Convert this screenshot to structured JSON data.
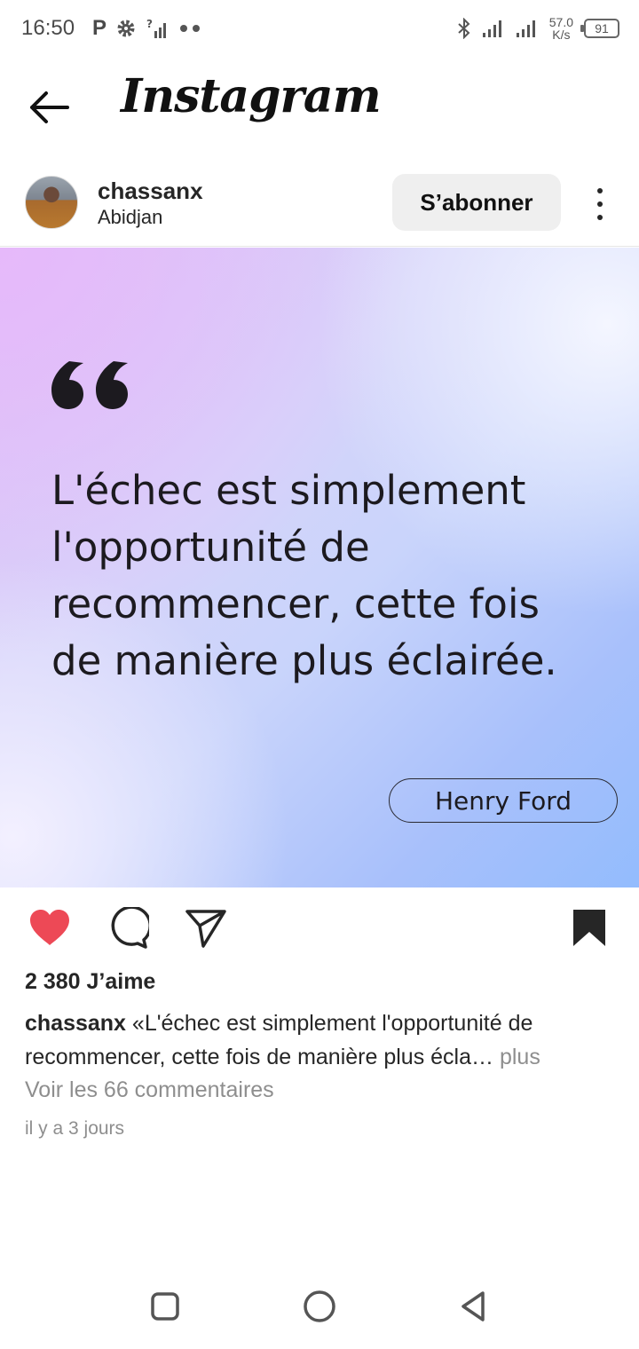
{
  "status_bar": {
    "time": "16:50",
    "left_icons": [
      "parking-icon",
      "gear-icon",
      "signal-unknown-icon",
      "dots-icon"
    ],
    "network_speed_value": "57.0",
    "network_speed_unit": "K/s",
    "battery_level": "91"
  },
  "header": {
    "brand": "Instagram",
    "back_icon": "arrow-left-icon"
  },
  "post": {
    "username": "chassanx",
    "location": "Abidjan",
    "follow_label": "S’abonner",
    "image": {
      "quote_text": "L'échec est simplement l'opportunité de recommencer, cette fois de manière plus éclairée.",
      "author": "Henry Ford",
      "gradient_colors": [
        "#dcc3f7",
        "#c9d4fb",
        "#93bcfd"
      ]
    },
    "liked": true,
    "like_color": "#ed4956",
    "likes": "2 380 J’aime",
    "caption_user": "chassanx",
    "caption_text": " «L'échec est simplement l'opportunité de recommencer, cette fois de manière plus écla…",
    "caption_more": " plus",
    "comments_link": "Voir les 66 commentaires",
    "timestamp": "il y a 3 jours"
  },
  "nav": {
    "buttons": [
      "recents-square-icon",
      "home-circle-icon",
      "back-triangle-icon"
    ]
  }
}
